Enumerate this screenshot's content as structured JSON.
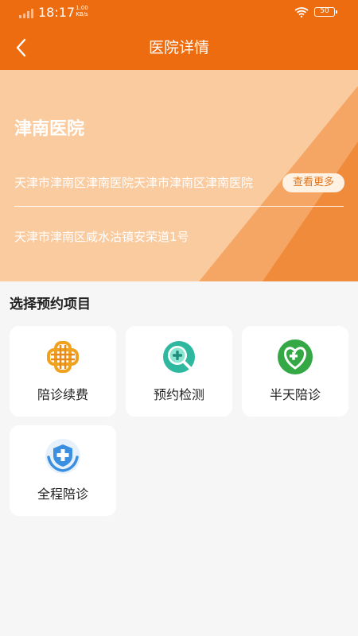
{
  "status_bar": {
    "time": "18:17",
    "net_speed_value": "1.00",
    "net_speed_unit": "KB/s",
    "battery": "50",
    "icons": [
      "signal-icon",
      "wifi-icon",
      "battery-icon"
    ]
  },
  "header": {
    "title": "医院详情",
    "back_icon": "chevron-left-icon",
    "color": "#ee6c10"
  },
  "hospital": {
    "name": "津南医院",
    "description": "天津市津南区津南医院天津市津南区津南医院",
    "more_label": "查看更多",
    "address": "天津市津南区咸水沽镇安荣道1号",
    "hero_color": "#fbcba0"
  },
  "section": {
    "title": "选择预约项目"
  },
  "services": [
    {
      "label": "陪诊续费",
      "icon": "orange-knot-icon"
    },
    {
      "label": "预约检测",
      "icon": "medical-search-icon"
    },
    {
      "label": "半天陪诊",
      "icon": "heart-cross-icon"
    },
    {
      "label": "全程陪诊",
      "icon": "hands-cross-icon"
    }
  ]
}
